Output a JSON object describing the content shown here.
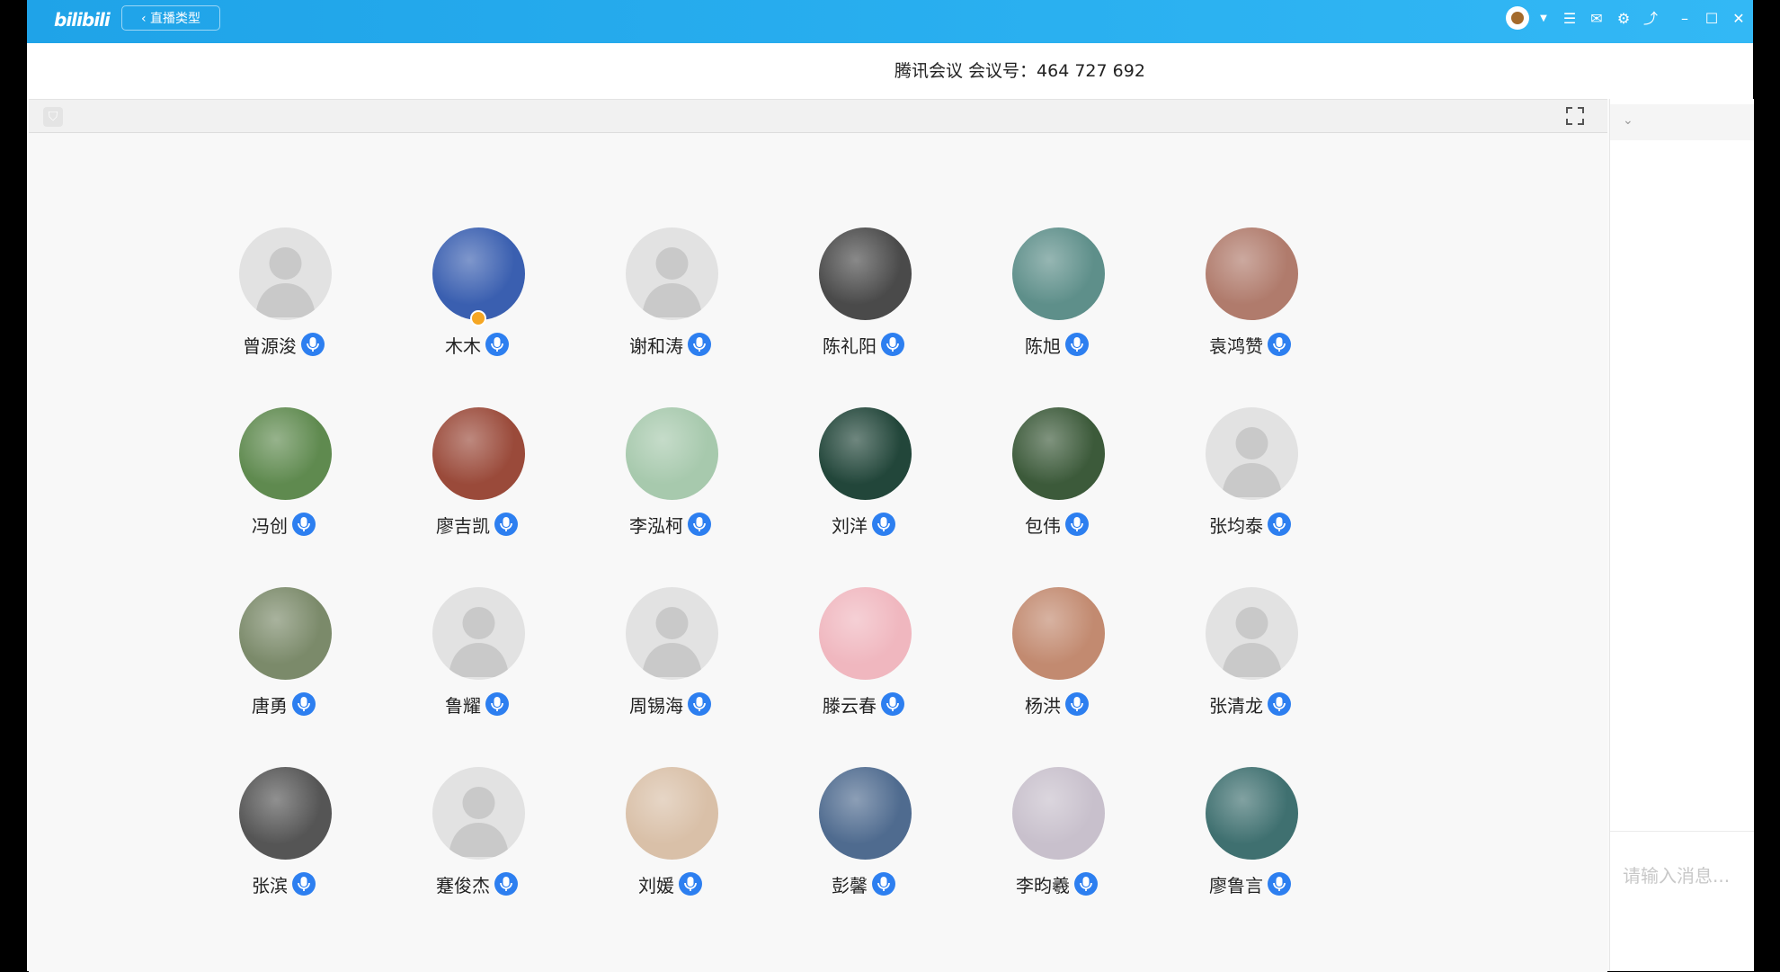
{
  "titlebar": {
    "logo": "bilibili",
    "back_label": "‹ 直播类型",
    "icons": [
      "user-avatar",
      "chevron-down-icon",
      "menu-icon",
      "mail-icon",
      "settings-icon",
      "share-icon",
      "minimize-icon",
      "maximize-icon",
      "close-icon"
    ]
  },
  "meeting": {
    "title": "腾讯会议 会议号：464 727 692"
  },
  "participants": [
    {
      "name": "曾源浚",
      "avatar": "default",
      "color": ""
    },
    {
      "name": "木木",
      "avatar": "photo",
      "color": "#3a5fb0",
      "host": true
    },
    {
      "name": "谢和涛",
      "avatar": "default",
      "color": ""
    },
    {
      "name": "陈礼阳",
      "avatar": "photo",
      "color": "#4a4a4a"
    },
    {
      "name": "陈旭",
      "avatar": "photo",
      "color": "#5e8f8a"
    },
    {
      "name": "袁鸿赞",
      "avatar": "photo",
      "color": "#b07b6c"
    },
    {
      "name": "冯创",
      "avatar": "photo",
      "color": "#5f8a4f"
    },
    {
      "name": "廖吉凯",
      "avatar": "photo",
      "color": "#9a4a3a"
    },
    {
      "name": "李泓柯",
      "avatar": "photo",
      "color": "#a7c9ad"
    },
    {
      "name": "刘洋",
      "avatar": "photo",
      "color": "#22463a"
    },
    {
      "name": "包伟",
      "avatar": "photo",
      "color": "#3c5a3a"
    },
    {
      "name": "张均泰",
      "avatar": "default",
      "color": ""
    },
    {
      "name": "唐勇",
      "avatar": "photo",
      "color": "#7b8a6a"
    },
    {
      "name": "鲁耀",
      "avatar": "default",
      "color": ""
    },
    {
      "name": "周锡海",
      "avatar": "default",
      "color": ""
    },
    {
      "name": "滕云春",
      "avatar": "photo",
      "color": "#f0b7bf"
    },
    {
      "name": "杨洪",
      "avatar": "photo",
      "color": "#c28a70"
    },
    {
      "name": "张清龙",
      "avatar": "default",
      "color": ""
    },
    {
      "name": "张滨",
      "avatar": "photo",
      "color": "#555555"
    },
    {
      "name": "蹇俊杰",
      "avatar": "default",
      "color": ""
    },
    {
      "name": "刘媛",
      "avatar": "photo",
      "color": "#d9c0a8"
    },
    {
      "name": "彭馨",
      "avatar": "photo",
      "color": "#4f6b8f"
    },
    {
      "name": "李昀羲",
      "avatar": "photo",
      "color": "#c8c0cc"
    },
    {
      "name": "廖鲁言",
      "avatar": "photo",
      "color": "#3f7070"
    }
  ],
  "chat": {
    "input_placeholder": "请输入消息..."
  },
  "colors": {
    "titlebar": "#2ab0f0",
    "mic": "#2d7ff0"
  }
}
